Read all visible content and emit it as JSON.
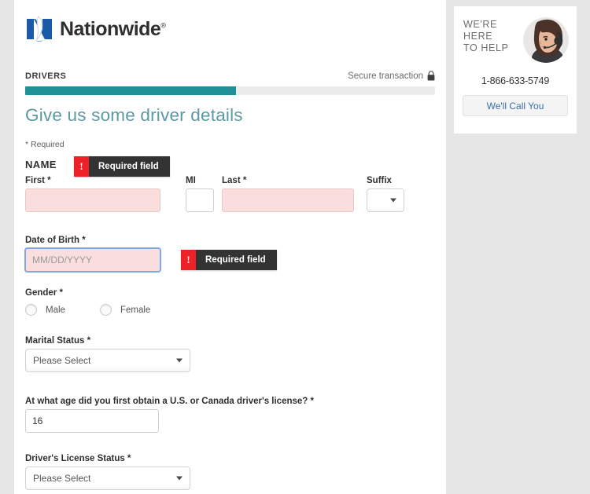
{
  "brand": {
    "name": "Nationwide",
    "registered_mark": "®",
    "logo_color": "#1b5aa7"
  },
  "progress": {
    "step_label": "DRIVERS",
    "secure_label": "Secure transaction",
    "percent": 51.5,
    "fill_color": "#1f8f98",
    "track_color": "#ececec"
  },
  "page": {
    "heading": "Give us some driver details",
    "heading_color": "#5b9aa4",
    "required_note": "* Required"
  },
  "errors": {
    "required_field": "Required field",
    "bang_glyph": "!",
    "badge_color": "#ee2028",
    "body_color": "#333333"
  },
  "form": {
    "name_section_label": "NAME",
    "first": {
      "label": "First *",
      "value": "",
      "state": "error"
    },
    "mi": {
      "label": "MI",
      "value": "",
      "state": "normal"
    },
    "last": {
      "label": "Last *",
      "value": "",
      "state": "error"
    },
    "suffix": {
      "label": "Suffix",
      "value": "",
      "state": "normal"
    },
    "dob": {
      "label": "Date of Birth *",
      "placeholder": "MM/DD/YYYY",
      "value": "",
      "state": "error-focused"
    },
    "gender": {
      "label": "Gender *",
      "options": [
        {
          "label": "Male",
          "selected": false
        },
        {
          "label": "Female",
          "selected": false
        }
      ]
    },
    "marital_status": {
      "label": "Marital Status *",
      "value": "Please Select"
    },
    "license_age": {
      "label": "At what age did you first obtain a U.S. or Canada driver's license? *",
      "value": "16"
    },
    "license_status": {
      "label": "Driver's License Status *",
      "value": "Please Select"
    }
  },
  "help": {
    "title": "WE'RE\nHERE\nTO HELP",
    "phone": "1-866-633-5749",
    "call_button": "We'll Call You",
    "link_color": "#3a6ea8"
  }
}
